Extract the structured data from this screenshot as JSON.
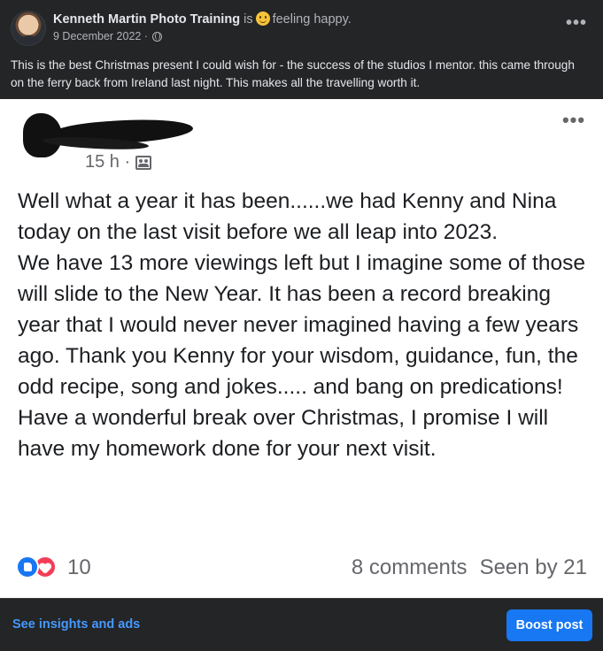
{
  "post": {
    "page_name": "Kenneth Martin Photo Training",
    "is_word": "is",
    "feeling": "feeling happy.",
    "date": "9 December 2022 ·",
    "more_icon": "more-horizontal-icon",
    "caption": "This is the best Christmas present I could wish for - the success of the studios I mentor. this came through on the ferry back from Ireland last night. This makes all the travelling worth it."
  },
  "shared_post": {
    "time": "15 h ·",
    "paragraphs": [
      "Well what a year it has been......we had Kenny and Nina today on the last visit before we all leap into 2023.",
      "We have 13 more viewings left but I imagine some of those will slide to the New Year. It has been a record breaking year that I would never never imagined having a few years ago. Thank you Kenny for your wisdom, guidance,  fun, the odd recipe, song and jokes..... and bang on predications! Have a wonderful break over Christmas, I promise I will have my homework done for your next visit."
    ],
    "reaction_count": "10",
    "comments": "8 comments",
    "seen_by": "Seen by 21",
    "colors": {
      "like": "#1877f2",
      "love": "#f33e58"
    }
  },
  "footer": {
    "insights_label": "See insights and ads",
    "boost_label": "Boost post"
  }
}
